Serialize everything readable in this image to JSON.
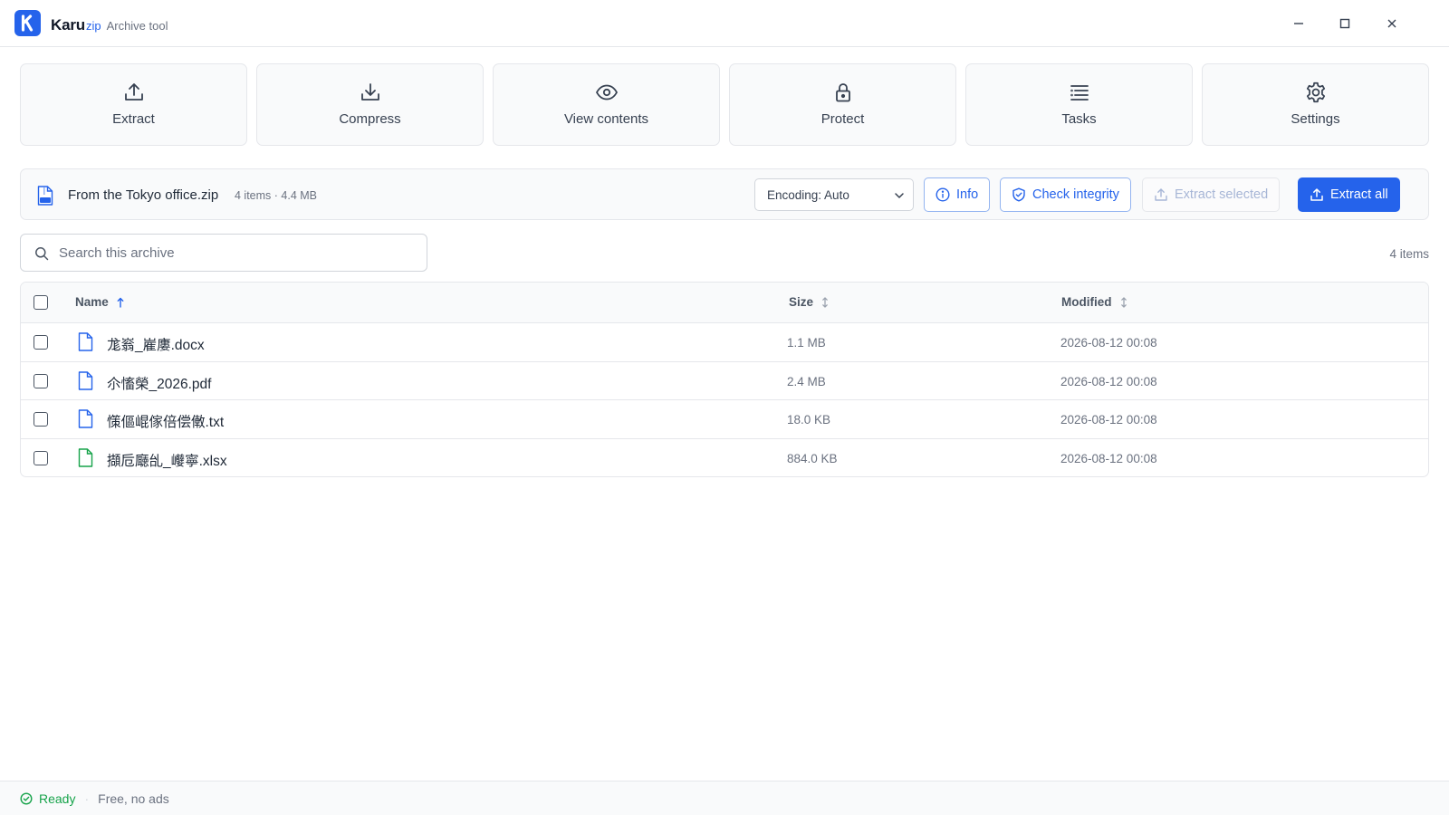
{
  "app": {
    "brand": "Karu",
    "brand_suffix": "zip",
    "subtitle": "Archive tool",
    "logo_letter": "K",
    "accent_color": "#2563eb"
  },
  "window_controls": {
    "minimize": "minimize-icon",
    "maximize": "maximize-icon",
    "close": "close-icon"
  },
  "toolbar": [
    {
      "label": "Extract",
      "icon": "upload-icon"
    },
    {
      "label": "Compress",
      "icon": "download-icon"
    },
    {
      "label": "View contents",
      "icon": "eye-icon"
    },
    {
      "label": "Protect",
      "icon": "lock-icon"
    },
    {
      "label": "Tasks",
      "icon": "list-icon"
    },
    {
      "label": "Settings",
      "icon": "gear-icon"
    }
  ],
  "archive": {
    "name": "From the Tokyo office.zip",
    "meta": "4 items · 4.4 MB",
    "encoding": "Encoding: Auto",
    "buttons": {
      "info": "Info",
      "check": "Check integrity",
      "extract_selected": "Extract selected",
      "extract_all": "Extract all"
    }
  },
  "search": {
    "placeholder": "Search this archive",
    "value": ""
  },
  "item_count": "4 items",
  "table": {
    "columns": {
      "name": "Name",
      "size": "Size",
      "modified": "Modified"
    },
    "sort": {
      "column": "Name",
      "direction": "ascending"
    },
    "rows": [
      {
        "name": "尨嵡_嵟廔.docx",
        "size": "1.1 MB",
        "modified": "2026-08-12 00:08",
        "icon_color": "#2563eb"
      },
      {
        "name": "尒慉榮_2026.pdf",
        "size": "2.4 MB",
        "modified": "2026-08-12 00:08",
        "icon_color": "#2563eb"
      },
      {
        "name": "憡傴崐傢倍偿僌.txt",
        "size": "18.0 KB",
        "modified": "2026-08-12 00:08",
        "icon_color": "#2563eb"
      },
      {
        "name": "擷卮廰乨_巕寧.xlsx",
        "size": "884.0 KB",
        "modified": "2026-08-12 00:08",
        "icon_color": "#16a34a"
      }
    ]
  },
  "status": {
    "state": "Ready",
    "note": "Free, no ads",
    "ready_color": "#16a34a"
  }
}
